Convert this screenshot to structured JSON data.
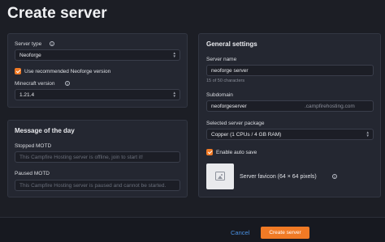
{
  "page": {
    "title": "Create server"
  },
  "server": {
    "type_label": "Server type",
    "type_value": "Neoforge",
    "use_recommended_label": "Use recommended Neoforge version",
    "use_recommended_checked": true,
    "version_label": "Minecraft version",
    "version_value": "1.21.4"
  },
  "motd": {
    "heading": "Message of the day",
    "stopped_label": "Stopped MOTD",
    "stopped_placeholder": "This Campfire Hosting server is offline, join to start it!",
    "paused_label": "Paused MOTD",
    "paused_placeholder": "This Campfire Hosting server is paused and cannot be started."
  },
  "general": {
    "heading": "General settings",
    "name_label": "Server name",
    "name_value": "neoforge server",
    "name_counter": "15 of 50 characters",
    "subdomain_label": "Subdomain",
    "subdomain_value": "neoforgeserver",
    "subdomain_suffix": ".campfirehosting.com",
    "package_label": "Selected server package",
    "package_value": "Copper (1 CPUs / 4 GB RAM)",
    "autosave_label": "Enable auto save",
    "autosave_checked": true,
    "favicon_label": "Server favicon (64 × 64 pixels)"
  },
  "footer": {
    "cancel_label": "Cancel",
    "create_label": "Create server"
  },
  "colors": {
    "accent": "#f07a25",
    "link": "#4a90e2",
    "background": "#1c1e25",
    "panel": "#242731"
  },
  "icons": [
    "info-icon",
    "checkbox-checked-icon",
    "select-arrows-icon",
    "image-placeholder-icon"
  ]
}
